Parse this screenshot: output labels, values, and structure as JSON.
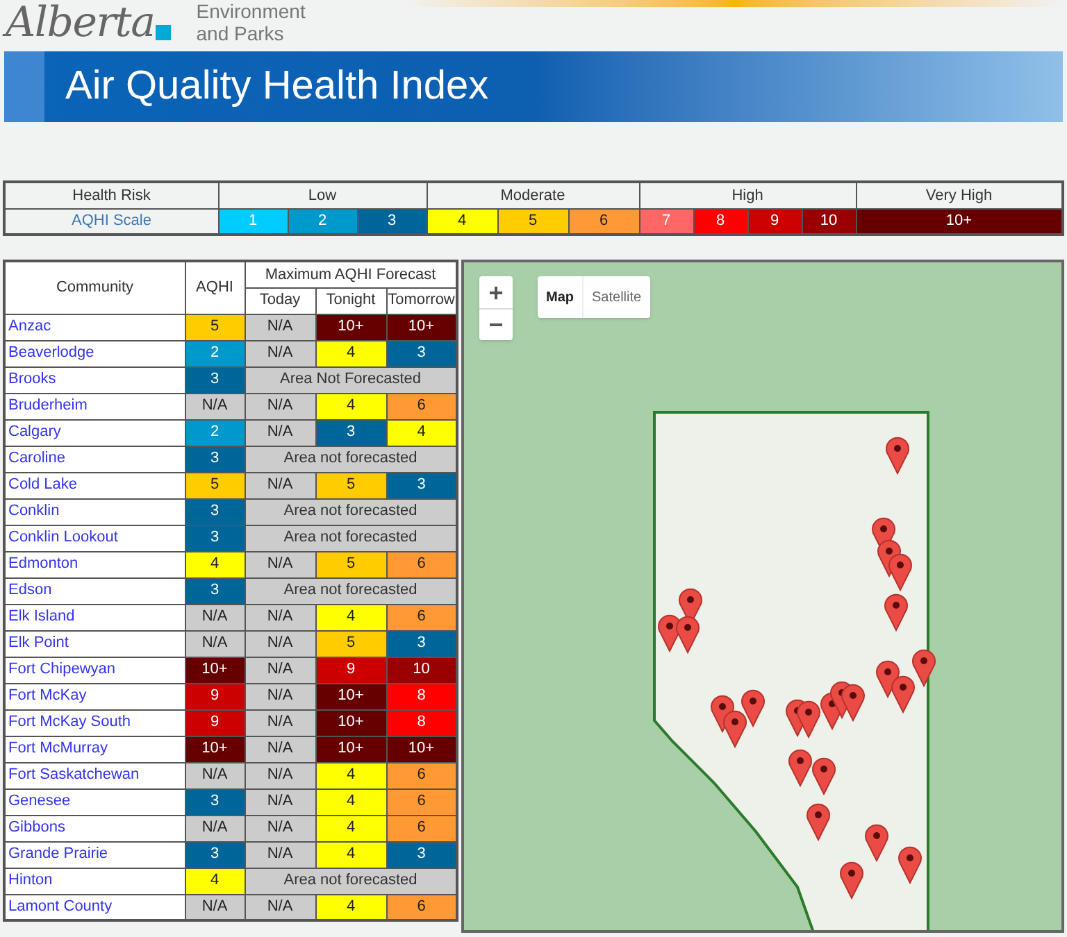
{
  "header": {
    "logo_text": "Alberta",
    "ministry_lines": [
      "Environment",
      "and Parks"
    ],
    "banner_title": "Air Quality Health Index"
  },
  "scale": {
    "header_label": "Health Risk",
    "row_label": "AQHI Scale",
    "risk_levels": [
      {
        "label": "Low",
        "values": [
          {
            "label": "1",
            "color": "#00ccff"
          },
          {
            "label": "2",
            "color": "#0099cc"
          },
          {
            "label": "3",
            "color": "#006699"
          }
        ]
      },
      {
        "label": "Moderate",
        "values": [
          {
            "label": "4",
            "color": "#ffff00"
          },
          {
            "label": "5",
            "color": "#ffcc00"
          },
          {
            "label": "6",
            "color": "#ff9933"
          }
        ]
      },
      {
        "label": "High",
        "values": [
          {
            "label": "7",
            "color": "#ff6666"
          },
          {
            "label": "8",
            "color": "#ff0000"
          },
          {
            "label": "9",
            "color": "#cc0000"
          },
          {
            "label": "10",
            "color": "#990000"
          }
        ]
      },
      {
        "label": "Very High",
        "values": [
          {
            "label": "10+",
            "color": "#660000"
          }
        ]
      }
    ]
  },
  "table": {
    "columns": {
      "community": "Community",
      "aqhi": "AQHI",
      "forecast_group": "Maximum AQHI Forecast",
      "forecast": [
        "Today",
        "Tonight",
        "Tomorrow"
      ]
    },
    "rows": [
      {
        "community": "Anzac",
        "aqhi": {
          "text": "5",
          "color": "#ffcc00"
        },
        "forecast": [
          {
            "text": "N/A",
            "color": "#cccccc"
          },
          {
            "text": "10+",
            "color": "#660000"
          },
          {
            "text": "10+",
            "color": "#660000"
          }
        ]
      },
      {
        "community": "Beaverlodge",
        "aqhi": {
          "text": "2",
          "color": "#0099cc"
        },
        "forecast": [
          {
            "text": "N/A",
            "color": "#cccccc"
          },
          {
            "text": "4",
            "color": "#ffff00"
          },
          {
            "text": "3",
            "color": "#006699"
          }
        ]
      },
      {
        "community": "Brooks",
        "aqhi": {
          "text": "3",
          "color": "#006699"
        },
        "note": "Area Not Forecasted"
      },
      {
        "community": "Bruderheim",
        "aqhi": {
          "text": "N/A",
          "color": "#cccccc"
        },
        "forecast": [
          {
            "text": "N/A",
            "color": "#cccccc"
          },
          {
            "text": "4",
            "color": "#ffff00"
          },
          {
            "text": "6",
            "color": "#ff9933"
          }
        ]
      },
      {
        "community": "Calgary",
        "aqhi": {
          "text": "2",
          "color": "#0099cc"
        },
        "forecast": [
          {
            "text": "N/A",
            "color": "#cccccc"
          },
          {
            "text": "3",
            "color": "#006699"
          },
          {
            "text": "4",
            "color": "#ffff00"
          }
        ]
      },
      {
        "community": "Caroline",
        "aqhi": {
          "text": "3",
          "color": "#006699"
        },
        "note": "Area not forecasted"
      },
      {
        "community": "Cold Lake",
        "aqhi": {
          "text": "5",
          "color": "#ffcc00"
        },
        "forecast": [
          {
            "text": "N/A",
            "color": "#cccccc"
          },
          {
            "text": "5",
            "color": "#ffcc00"
          },
          {
            "text": "3",
            "color": "#006699"
          }
        ]
      },
      {
        "community": "Conklin",
        "aqhi": {
          "text": "3",
          "color": "#006699"
        },
        "note": "Area not forecasted"
      },
      {
        "community": "Conklin Lookout",
        "aqhi": {
          "text": "3",
          "color": "#006699"
        },
        "note": "Area not forecasted"
      },
      {
        "community": "Edmonton",
        "aqhi": {
          "text": "4",
          "color": "#ffff00"
        },
        "forecast": [
          {
            "text": "N/A",
            "color": "#cccccc"
          },
          {
            "text": "5",
            "color": "#ffcc00"
          },
          {
            "text": "6",
            "color": "#ff9933"
          }
        ]
      },
      {
        "community": "Edson",
        "aqhi": {
          "text": "3",
          "color": "#006699"
        },
        "note": "Area not forecasted"
      },
      {
        "community": "Elk Island",
        "aqhi": {
          "text": "N/A",
          "color": "#cccccc"
        },
        "forecast": [
          {
            "text": "N/A",
            "color": "#cccccc"
          },
          {
            "text": "4",
            "color": "#ffff00"
          },
          {
            "text": "6",
            "color": "#ff9933"
          }
        ]
      },
      {
        "community": "Elk Point",
        "aqhi": {
          "text": "N/A",
          "color": "#cccccc"
        },
        "forecast": [
          {
            "text": "N/A",
            "color": "#cccccc"
          },
          {
            "text": "5",
            "color": "#ffcc00"
          },
          {
            "text": "3",
            "color": "#006699"
          }
        ]
      },
      {
        "community": "Fort Chipewyan",
        "aqhi": {
          "text": "10+",
          "color": "#660000"
        },
        "forecast": [
          {
            "text": "N/A",
            "color": "#cccccc"
          },
          {
            "text": "9",
            "color": "#cc0000"
          },
          {
            "text": "10",
            "color": "#990000"
          }
        ]
      },
      {
        "community": "Fort McKay",
        "aqhi": {
          "text": "9",
          "color": "#cc0000"
        },
        "forecast": [
          {
            "text": "N/A",
            "color": "#cccccc"
          },
          {
            "text": "10+",
            "color": "#660000"
          },
          {
            "text": "8",
            "color": "#ff0000"
          }
        ]
      },
      {
        "community": "Fort McKay South",
        "aqhi": {
          "text": "9",
          "color": "#cc0000"
        },
        "forecast": [
          {
            "text": "N/A",
            "color": "#cccccc"
          },
          {
            "text": "10+",
            "color": "#660000"
          },
          {
            "text": "8",
            "color": "#ff0000"
          }
        ]
      },
      {
        "community": "Fort McMurray",
        "aqhi": {
          "text": "10+",
          "color": "#660000"
        },
        "forecast": [
          {
            "text": "N/A",
            "color": "#cccccc"
          },
          {
            "text": "10+",
            "color": "#660000"
          },
          {
            "text": "10+",
            "color": "#660000"
          }
        ]
      },
      {
        "community": "Fort Saskatchewan",
        "aqhi": {
          "text": "N/A",
          "color": "#cccccc"
        },
        "forecast": [
          {
            "text": "N/A",
            "color": "#cccccc"
          },
          {
            "text": "4",
            "color": "#ffff00"
          },
          {
            "text": "6",
            "color": "#ff9933"
          }
        ]
      },
      {
        "community": "Genesee",
        "aqhi": {
          "text": "3",
          "color": "#006699"
        },
        "forecast": [
          {
            "text": "N/A",
            "color": "#cccccc"
          },
          {
            "text": "4",
            "color": "#ffff00"
          },
          {
            "text": "6",
            "color": "#ff9933"
          }
        ]
      },
      {
        "community": "Gibbons",
        "aqhi": {
          "text": "N/A",
          "color": "#cccccc"
        },
        "forecast": [
          {
            "text": "N/A",
            "color": "#cccccc"
          },
          {
            "text": "4",
            "color": "#ffff00"
          },
          {
            "text": "6",
            "color": "#ff9933"
          }
        ]
      },
      {
        "community": "Grande Prairie",
        "aqhi": {
          "text": "3",
          "color": "#006699"
        },
        "forecast": [
          {
            "text": "N/A",
            "color": "#cccccc"
          },
          {
            "text": "4",
            "color": "#ffff00"
          },
          {
            "text": "3",
            "color": "#006699"
          }
        ]
      },
      {
        "community": "Hinton",
        "aqhi": {
          "text": "4",
          "color": "#ffff00"
        },
        "note": "Area not forecasted"
      },
      {
        "community": "Lamont County",
        "aqhi": {
          "text": "N/A",
          "color": "#cccccc"
        },
        "forecast": [
          {
            "text": "N/A",
            "color": "#cccccc"
          },
          {
            "text": "4",
            "color": "#ffff00"
          },
          {
            "text": "6",
            "color": "#ff9933"
          }
        ]
      }
    ]
  },
  "map": {
    "zoom_in": "+",
    "zoom_out": "−",
    "map_types": [
      {
        "label": "Map",
        "selected": true
      },
      {
        "label": "Satellite",
        "selected": false
      }
    ]
  }
}
